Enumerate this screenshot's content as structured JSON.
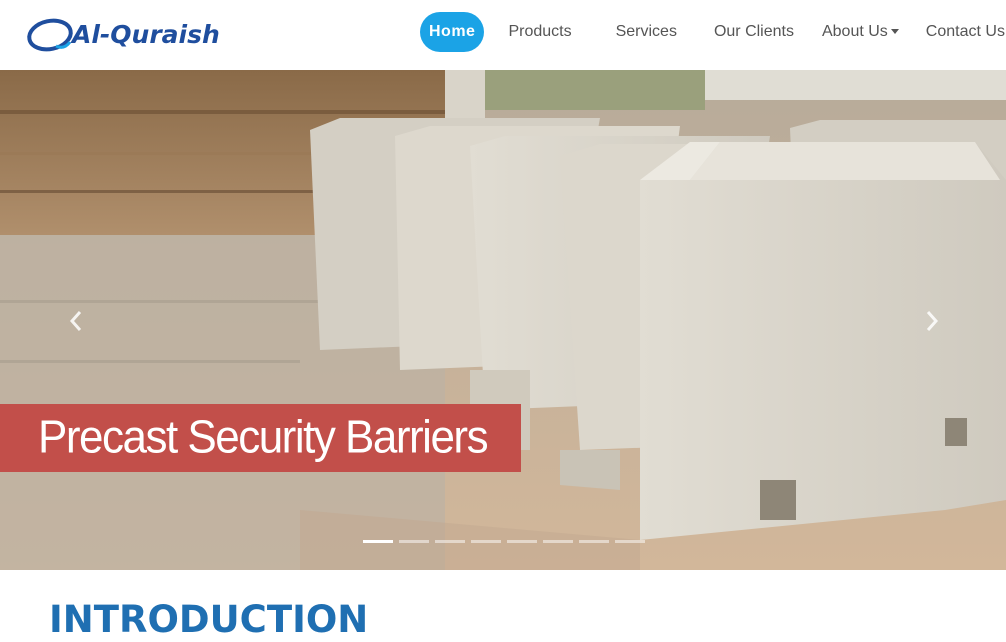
{
  "brand": {
    "name": "Al-Quraish"
  },
  "nav": {
    "items": [
      {
        "label": "Home",
        "active": true
      },
      {
        "label": "Products",
        "active": false
      },
      {
        "label": "Services",
        "active": false
      },
      {
        "label": "Our Clients",
        "active": false
      },
      {
        "label": "About Us",
        "active": false,
        "dropdown": true
      },
      {
        "label": "Contact Us",
        "active": false
      }
    ]
  },
  "carousel": {
    "slide_caption": "Precast Security Barriers",
    "slide_count": 8,
    "active_slide": 1,
    "prev_icon": "chevron-left-icon",
    "next_icon": "chevron-right-icon"
  },
  "intro": {
    "title": "INTRODUCTION"
  },
  "colors": {
    "accent": "#1ba3e6",
    "brand": "#1f4e9e",
    "caption_bg": "#c24f4a",
    "heading": "#1f6fb2"
  }
}
